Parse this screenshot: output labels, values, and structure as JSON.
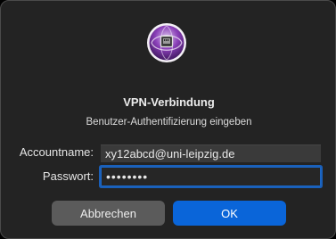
{
  "dialog": {
    "icon": "vpn-network-icon",
    "title": "VPN-Verbindung",
    "subtitle": "Benutzer-Authentifizierung eingeben"
  },
  "form": {
    "account_label": "Accountname:",
    "account_value": "xy12abcd@uni-leipzig.de",
    "password_label": "Passwort:",
    "password_value": "••••••••"
  },
  "buttons": {
    "cancel_label": "Abbrechen",
    "ok_label": "OK"
  },
  "colors": {
    "dialog_background": "#232323",
    "accent_blue": "#0a65d9",
    "focus_ring": "#1a5fb8",
    "secondary_button": "#5b5b5b",
    "icon_purple": "#8a3fb8"
  }
}
